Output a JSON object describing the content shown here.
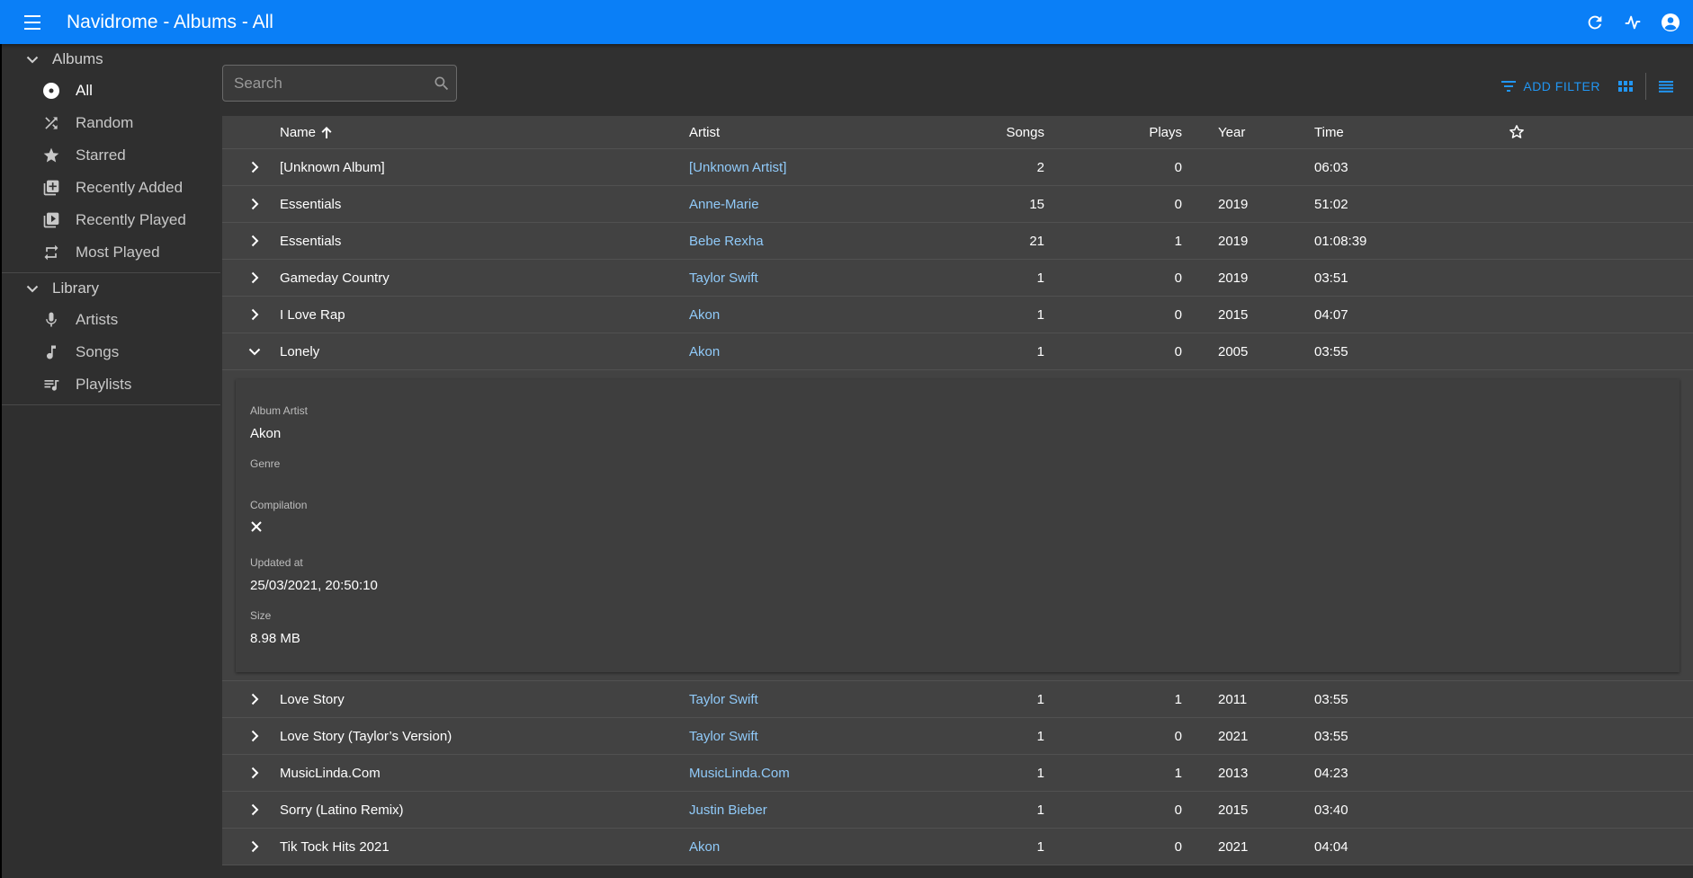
{
  "app": {
    "title": "Navidrome - Albums - All"
  },
  "appbar_icons": [
    "refresh-icon",
    "activity-icon",
    "account-circle-icon"
  ],
  "sidebar": {
    "groups": [
      {
        "label": "Albums",
        "items": [
          {
            "label": "All",
            "icon": "album-disc-icon",
            "active": true
          },
          {
            "label": "Random",
            "icon": "shuffle-icon"
          },
          {
            "label": "Starred",
            "icon": "star-icon"
          },
          {
            "label": "Recently Added",
            "icon": "library-add-icon"
          },
          {
            "label": "Recently Played",
            "icon": "video-library-icon"
          },
          {
            "label": "Most Played",
            "icon": "repeat-icon"
          }
        ]
      },
      {
        "label": "Library",
        "items": [
          {
            "label": "Artists",
            "icon": "microphone-icon"
          },
          {
            "label": "Songs",
            "icon": "music-note-icon"
          },
          {
            "label": "Playlists",
            "icon": "queue-music-icon"
          }
        ]
      }
    ]
  },
  "toolbar": {
    "search_placeholder": "Search",
    "add_filter_label": "ADD FILTER"
  },
  "table": {
    "headers": {
      "name": "Name",
      "artist": "Artist",
      "songs": "Songs",
      "plays": "Plays",
      "year": "Year",
      "time": "Time"
    },
    "rows_before": [
      {
        "name": "[Unknown Album]",
        "artist": "[Unknown Artist]",
        "songs": "2",
        "plays": "0",
        "year": "",
        "time": "06:03"
      },
      {
        "name": "Essentials",
        "artist": "Anne-Marie",
        "songs": "15",
        "plays": "0",
        "year": "2019",
        "time": "51:02"
      },
      {
        "name": "Essentials",
        "artist": "Bebe Rexha",
        "songs": "21",
        "plays": "1",
        "year": "2019",
        "time": "01:08:39"
      },
      {
        "name": "Gameday Country",
        "artist": "Taylor Swift",
        "songs": "1",
        "plays": "0",
        "year": "2019",
        "time": "03:51"
      },
      {
        "name": "I Love Rap",
        "artist": "Akon",
        "songs": "1",
        "plays": "0",
        "year": "2015",
        "time": "04:07"
      }
    ],
    "expanded_row": {
      "name": "Lonely",
      "artist": "Akon",
      "songs": "1",
      "plays": "0",
      "year": "2005",
      "time": "03:55"
    },
    "expanded_details": {
      "album_artist_label": "Album Artist",
      "album_artist": "Akon",
      "genre_label": "Genre",
      "genre": "",
      "compilation_label": "Compilation",
      "updated_label": "Updated at",
      "updated": "25/03/2021, 20:50:10",
      "size_label": "Size",
      "size": "8.98 MB"
    },
    "rows_after": [
      {
        "name": "Love Story",
        "artist": "Taylor Swift",
        "songs": "1",
        "plays": "1",
        "year": "2011",
        "time": "03:55"
      },
      {
        "name": "Love Story (Taylor’s Version)",
        "artist": "Taylor Swift",
        "songs": "1",
        "plays": "0",
        "year": "2021",
        "time": "03:55"
      },
      {
        "name": "MusicLinda.Com",
        "artist": "MusicLinda.Com",
        "songs": "1",
        "plays": "1",
        "year": "2013",
        "time": "04:23"
      },
      {
        "name": "Sorry (Latino Remix)",
        "artist": "Justin Bieber",
        "songs": "1",
        "plays": "0",
        "year": "2015",
        "time": "03:40"
      },
      {
        "name": "Tik Tock Hits 2021",
        "artist": "Akon",
        "songs": "1",
        "plays": "0",
        "year": "2021",
        "time": "04:04"
      }
    ]
  },
  "colors": {
    "appbar": "#0a7ff7",
    "link": "#90caf9",
    "accent": "#2196f3"
  }
}
